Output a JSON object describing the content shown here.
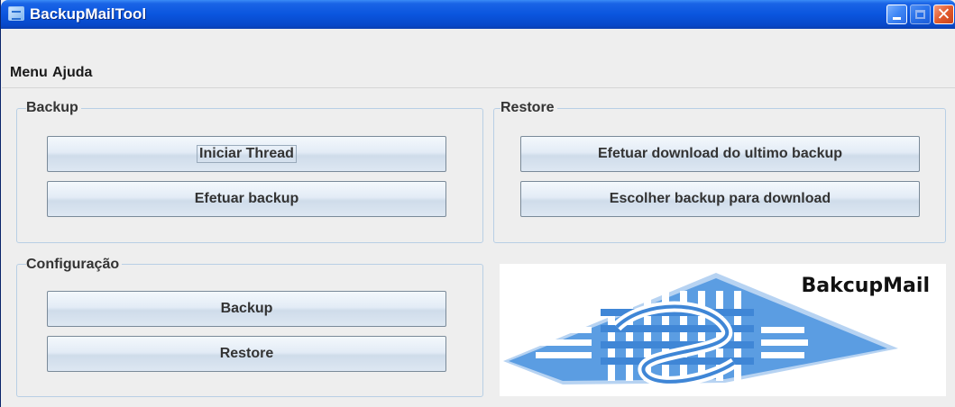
{
  "window": {
    "title": "BackupMailTool"
  },
  "titlebar": {
    "close_glyph": "✕",
    "icons": [
      "app-icon",
      "minimize-icon",
      "maximize-icon",
      "close-icon"
    ]
  },
  "menu": {
    "items": [
      "Menu",
      "Ajuda"
    ]
  },
  "backup": {
    "title": "Backup",
    "start_thread": "Iniciar Thread",
    "do_backup": "Efetuar backup"
  },
  "restore": {
    "title": "Restore",
    "download_last": "Efetuar download do ultimo backup",
    "choose_backup": "Escolher backup para download"
  },
  "config": {
    "title": "Configuração",
    "backup": "Backup",
    "restore": "Restore"
  },
  "logo": {
    "text": "BakcupMail",
    "colors": {
      "primary": "#4a90e2",
      "light": "#a5c8f0"
    }
  },
  "colors": {
    "titlebar": "#0a55de",
    "window_bg": "#eeeeee",
    "group_border": "#b8cfe5"
  }
}
